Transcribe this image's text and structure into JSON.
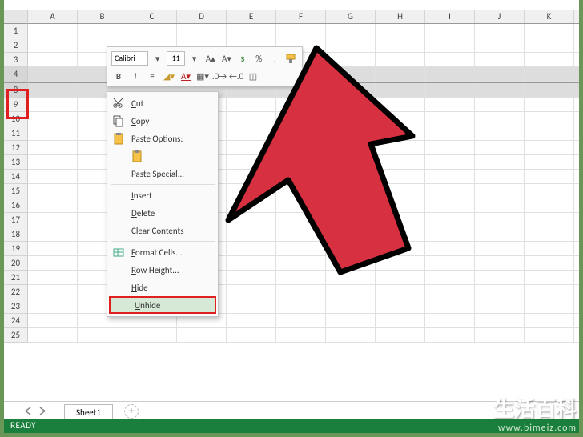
{
  "columns": [
    "A",
    "B",
    "C",
    "D",
    "E",
    "F",
    "G",
    "H",
    "I",
    "J",
    "K"
  ],
  "rows": [
    "1",
    "2",
    "3",
    "4",
    "8",
    "9",
    "10",
    "11",
    "12",
    "13",
    "14",
    "15",
    "16",
    "17",
    "18",
    "19",
    "20",
    "21",
    "22",
    "23",
    "24",
    "25"
  ],
  "selected_rows": [
    "4",
    "8"
  ],
  "mini_toolbar": {
    "font": "Calibri",
    "size": "11",
    "bold": "B",
    "italic": "I"
  },
  "context_menu": {
    "cut": "Cut",
    "copy": "Copy",
    "paste_options": "Paste Options:",
    "paste_special": "Paste Special...",
    "insert": "Insert",
    "delete": "Delete",
    "clear_contents": "Clear Contents",
    "format_cells": "Format Cells...",
    "row_height": "Row Height...",
    "hide": "Hide",
    "unhide": "Unhide"
  },
  "tabs": {
    "sheet1": "Sheet1",
    "add": "+"
  },
  "status": "READY",
  "watermark": {
    "line1": "生活百科",
    "line2": "www.bimeiz.com"
  }
}
